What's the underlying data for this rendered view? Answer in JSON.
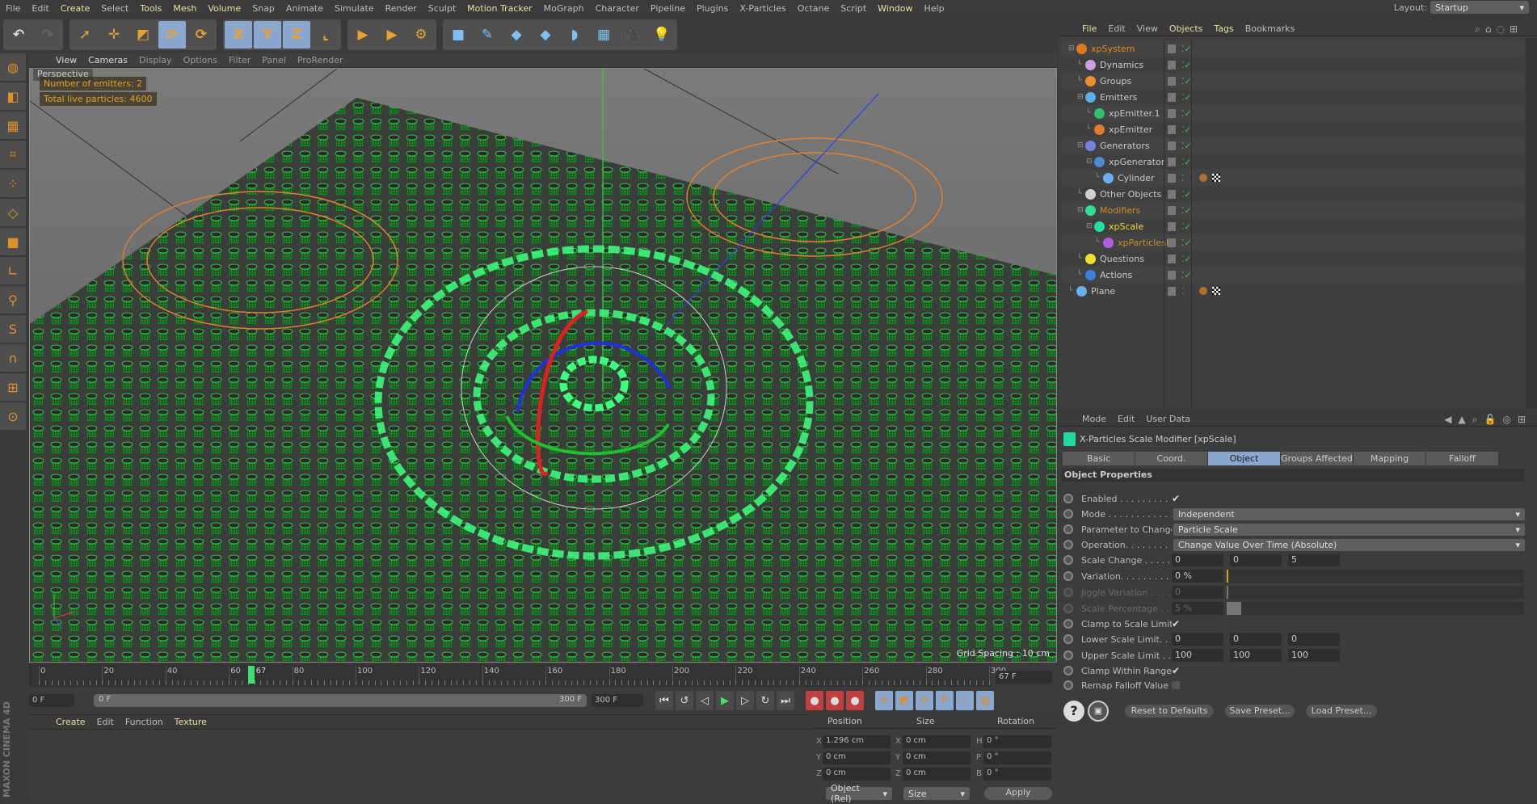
{
  "menubar": {
    "items": [
      "File",
      "Edit",
      "Create",
      "Select",
      "Tools",
      "Mesh",
      "Volume",
      "Snap",
      "Animate",
      "Simulate",
      "Render",
      "Sculpt",
      "Motion Tracker",
      "MoGraph",
      "Character",
      "Pipeline",
      "Plugins",
      "X-Particles",
      "Octane",
      "Script",
      "Window",
      "Help"
    ],
    "highlighted": [
      "Create",
      "Tools",
      "Mesh",
      "Volume",
      "Motion Tracker",
      "Window"
    ],
    "layout_label": "Layout:",
    "layout_value": "Startup"
  },
  "toolbar": {
    "groups": [
      {
        "buttons": [
          {
            "icon": "undo-icon",
            "glyph": "↶"
          },
          {
            "icon": "redo-icon",
            "glyph": "↷"
          }
        ]
      },
      {
        "buttons": [
          {
            "icon": "live-selection-icon",
            "glyph": "➚"
          },
          {
            "icon": "move-icon",
            "glyph": "✛"
          },
          {
            "icon": "scale-icon",
            "glyph": "◩"
          },
          {
            "icon": "rotate-icon",
            "glyph": "⟳",
            "on": true
          },
          {
            "icon": "recent-tool-icon",
            "glyph": "⟳"
          }
        ]
      },
      {
        "buttons": [
          {
            "icon": "x-axis-lock-icon",
            "glyph": "X",
            "on": true
          },
          {
            "icon": "y-axis-lock-icon",
            "glyph": "Y",
            "on": true
          },
          {
            "icon": "z-axis-lock-icon",
            "glyph": "Z",
            "on": true
          },
          {
            "icon": "coordinate-system-icon",
            "glyph": "⌞"
          }
        ]
      },
      {
        "buttons": [
          {
            "icon": "render-view-icon",
            "glyph": "▶"
          },
          {
            "icon": "render-picture-viewer-icon",
            "glyph": "▶"
          },
          {
            "icon": "render-settings-icon",
            "glyph": "⚙"
          }
        ]
      },
      {
        "buttons": [
          {
            "icon": "cube-icon",
            "glyph": "■"
          },
          {
            "icon": "pen-spline-icon",
            "glyph": "✎"
          },
          {
            "icon": "subdivision-icon",
            "glyph": "◆"
          },
          {
            "icon": "array-icon",
            "glyph": "◆"
          },
          {
            "icon": "deformer-icon",
            "glyph": "◗"
          },
          {
            "icon": "floor-icon",
            "glyph": "▦"
          },
          {
            "icon": "camera-icon",
            "glyph": "🎥"
          },
          {
            "icon": "light-icon",
            "glyph": "💡"
          }
        ]
      }
    ]
  },
  "left_toolbar": [
    "make-editable-icon",
    "model-mode-icon",
    "texture-mode-icon",
    "workplane-icon",
    "points-mode-icon",
    "edges-mode-icon",
    "polygons-mode-icon",
    "axis-icon",
    "tweak-icon",
    "solo-icon",
    "magnet-icon",
    "snap-lock-icon",
    "snap-icon"
  ],
  "viewport": {
    "menu": [
      "View",
      "Cameras",
      "Display",
      "Options",
      "Filter",
      "Panel",
      "ProRender"
    ],
    "menu_highlighted": [
      "View",
      "Cameras"
    ],
    "camera_label": "Perspective",
    "hud": [
      "Number of emitters: 2",
      "Total live particles: 4600"
    ],
    "grid_spacing": "Grid Spacing : 10 cm"
  },
  "timeline": {
    "ticks": [
      0,
      20,
      40,
      60,
      80,
      100,
      120,
      140,
      160,
      180,
      200,
      220,
      240,
      260,
      280,
      300
    ],
    "current_frame": 67,
    "current_frame_label": "67",
    "frame_field": "67 F",
    "start_field": "0 F",
    "range_start": "0 F",
    "range_end": "300 F",
    "end_field": "300 F",
    "playback": [
      "go-to-start-icon",
      "previous-key-icon",
      "previous-frame-icon",
      "play-icon",
      "next-frame-icon",
      "next-key-icon",
      "go-to-end-icon"
    ],
    "record": [
      "record-active-icon",
      "autokey-icon",
      "keyframe-selection-icon"
    ],
    "keytypes": [
      "key-position-icon",
      "key-scale-icon",
      "key-rotation-icon",
      "key-parameter-icon",
      "key-pla-icon",
      "timeline-icon"
    ]
  },
  "material_manager": {
    "menu": [
      "Create",
      "Edit",
      "Function",
      "Texture"
    ]
  },
  "coordinates": {
    "headers": [
      "Position",
      "Size",
      "Rotation"
    ],
    "rows": [
      {
        "pl": "X",
        "p": "1.296 cm",
        "sl": "X",
        "s": "0 cm",
        "rl": "H",
        "r": "0 °"
      },
      {
        "pl": "Y",
        "p": "0 cm",
        "sl": "Y",
        "s": "0 cm",
        "rl": "P",
        "r": "0 °"
      },
      {
        "pl": "Z",
        "p": "0 cm",
        "sl": "Z",
        "s": "0 cm",
        "rl": "B",
        "r": "0 °"
      }
    ],
    "mode": "Object (Rel)",
    "size_mode": "Size",
    "apply": "Apply"
  },
  "object_manager": {
    "menu": [
      "File",
      "Edit",
      "View",
      "Objects",
      "Tags",
      "Bookmarks"
    ],
    "menu_highlighted": [
      "File",
      "Objects",
      "Tags"
    ],
    "objects": [
      {
        "name": "xpSystem",
        "level": 0,
        "color": "#e08a2a",
        "icon": "#e07a20",
        "expander": true
      },
      {
        "name": "Dynamics",
        "level": 1,
        "color": "#c8c8c8",
        "icon": "#c9a0e0"
      },
      {
        "name": "Groups",
        "level": 1,
        "color": "#c8c8c8",
        "icon": "#f0902a"
      },
      {
        "name": "Emitters",
        "level": 1,
        "color": "#c8c8c8",
        "icon": "#5ab0e8",
        "expander": true
      },
      {
        "name": "xpEmitter.1",
        "level": 2,
        "color": "#c8c8c8",
        "icon": "#30c070"
      },
      {
        "name": "xpEmitter",
        "level": 2,
        "color": "#c8c8c8",
        "icon": "#e07a30"
      },
      {
        "name": "Generators",
        "level": 1,
        "color": "#c8c8c8",
        "icon": "#7a80e0",
        "expander": true
      },
      {
        "name": "xpGenerator",
        "level": 2,
        "color": "#c8c8c8",
        "icon": "#4a8ad0",
        "expander": true
      },
      {
        "name": "Cylinder",
        "level": 3,
        "color": "#c8c8c8",
        "icon": "#6ab0f0",
        "tags": true
      },
      {
        "name": "Other Objects",
        "level": 1,
        "color": "#c8c8c8",
        "icon": "#d0d0d0"
      },
      {
        "name": "Modifiers",
        "level": 1,
        "color": "#c8902a",
        "icon": "#30e090",
        "expander": true
      },
      {
        "name": "xpScale",
        "level": 2,
        "color": "#f0d840",
        "icon": "#20e0a0",
        "expander": true
      },
      {
        "name": "xpParticlesFalloff",
        "level": 3,
        "color": "#c8902a",
        "icon": "#b060e0"
      },
      {
        "name": "Questions",
        "level": 1,
        "color": "#c8c8c8",
        "icon": "#f0e030"
      },
      {
        "name": "Actions",
        "level": 1,
        "color": "#c8c8c8",
        "icon": "#3a80e0"
      },
      {
        "name": "Plane",
        "level": 0,
        "color": "#c8c8c8",
        "icon": "#6ab0f0",
        "tags": true
      }
    ]
  },
  "attributes": {
    "menu": [
      "Mode",
      "Edit",
      "User Data"
    ],
    "title": "X-Particles Scale Modifier [xpScale]",
    "tabs": [
      "Basic",
      "Coord.",
      "Object",
      "Groups Affected",
      "Mapping",
      "Falloff"
    ],
    "active_tab": "Object",
    "section": "Object Properties",
    "props": {
      "enabled": {
        "label": "Enabled . . . . . . . . . . . .",
        "checked": true
      },
      "mode": {
        "label": "Mode . . . . . . . . . . . . .",
        "value": "Independent"
      },
      "parameter": {
        "label": "Parameter to Change",
        "value": "Particle Scale"
      },
      "operation": {
        "label": "Operation. . . . . . . . . .",
        "value": "Change Value Over Time (Absolute)"
      },
      "scale_change": {
        "label": "Scale Change . . . . . . .",
        "values": [
          "0",
          "0",
          "5"
        ]
      },
      "variation": {
        "label": "Variation. . . . . . . . . . .",
        "value": "0 %",
        "level": 0
      },
      "jiggle": {
        "label": "Jiggle Variation . . . .",
        "value": "0"
      },
      "scale_percentage": {
        "label": "Scale Percentage . . .",
        "value": "5 %",
        "level": 5
      },
      "clamp_limit": {
        "label": "Clamp to Scale Limit",
        "checked": true
      },
      "lower": {
        "label": "Lower Scale Limit. . .",
        "values": [
          "0",
          "0",
          "0"
        ]
      },
      "upper": {
        "label": "Upper Scale Limit . .",
        "values": [
          "100",
          "100",
          "100"
        ]
      },
      "clamp_range": {
        "label": "Clamp Within Range",
        "checked": true
      },
      "remap": {
        "label": "Remap Falloff Value",
        "checked": false
      }
    },
    "buttons": {
      "reset": "Reset to Defaults",
      "save": "Save Preset...",
      "load": "Load Preset..."
    }
  },
  "branding": "MAXON CINEMA 4D"
}
